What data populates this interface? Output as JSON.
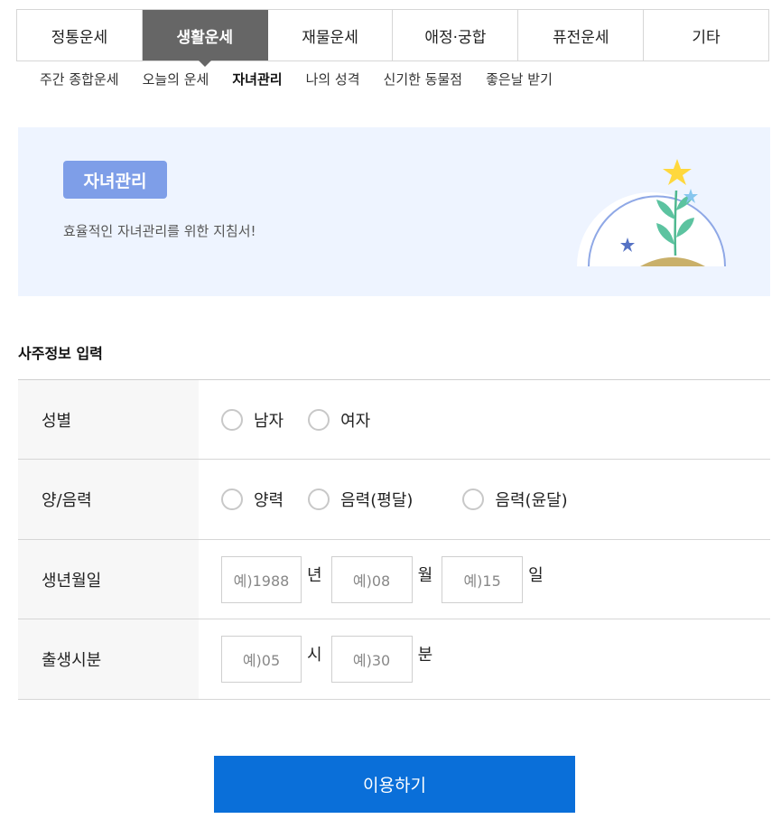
{
  "tabs": [
    {
      "label": "정통운세"
    },
    {
      "label": "생활운세"
    },
    {
      "label": "재물운세"
    },
    {
      "label": "애정·궁합"
    },
    {
      "label": "퓨전운세"
    },
    {
      "label": "기타"
    }
  ],
  "active_tab": "생활운세",
  "submenu": [
    {
      "label": "주간 종합운세"
    },
    {
      "label": "오늘의 운세"
    },
    {
      "label": "자녀관리"
    },
    {
      "label": "나의 성격"
    },
    {
      "label": "신기한 동물점"
    },
    {
      "label": "좋은날 받기"
    }
  ],
  "active_submenu": "자녀관리",
  "banner": {
    "badge": "자녀관리",
    "description": "효율적인 자녀관리를 위한 지침서!"
  },
  "section_title": "사주정보 입력",
  "form": {
    "gender": {
      "label": "성별",
      "options": [
        "남자",
        "여자"
      ]
    },
    "calendar": {
      "label": "양/음력",
      "options": [
        "양력",
        "음력(평달)",
        "음력(윤달)"
      ]
    },
    "birthdate": {
      "label": "생년월일",
      "year_placeholder": "예)1988",
      "year_unit": "년",
      "month_placeholder": "예)08",
      "month_unit": "월",
      "day_placeholder": "예)15",
      "day_unit": "일"
    },
    "birthtime": {
      "label": "출생시분",
      "hour_placeholder": "예)05",
      "hour_unit": "시",
      "minute_placeholder": "예)30",
      "minute_unit": "분"
    }
  },
  "submit_label": "이용하기",
  "colors": {
    "active_tab_bg": "#666666",
    "banner_bg": "#eef4ff",
    "badge_bg": "#7e9ee8",
    "submit_bg": "#0a6fd9",
    "label_cell_bg": "#f7f7f7"
  }
}
